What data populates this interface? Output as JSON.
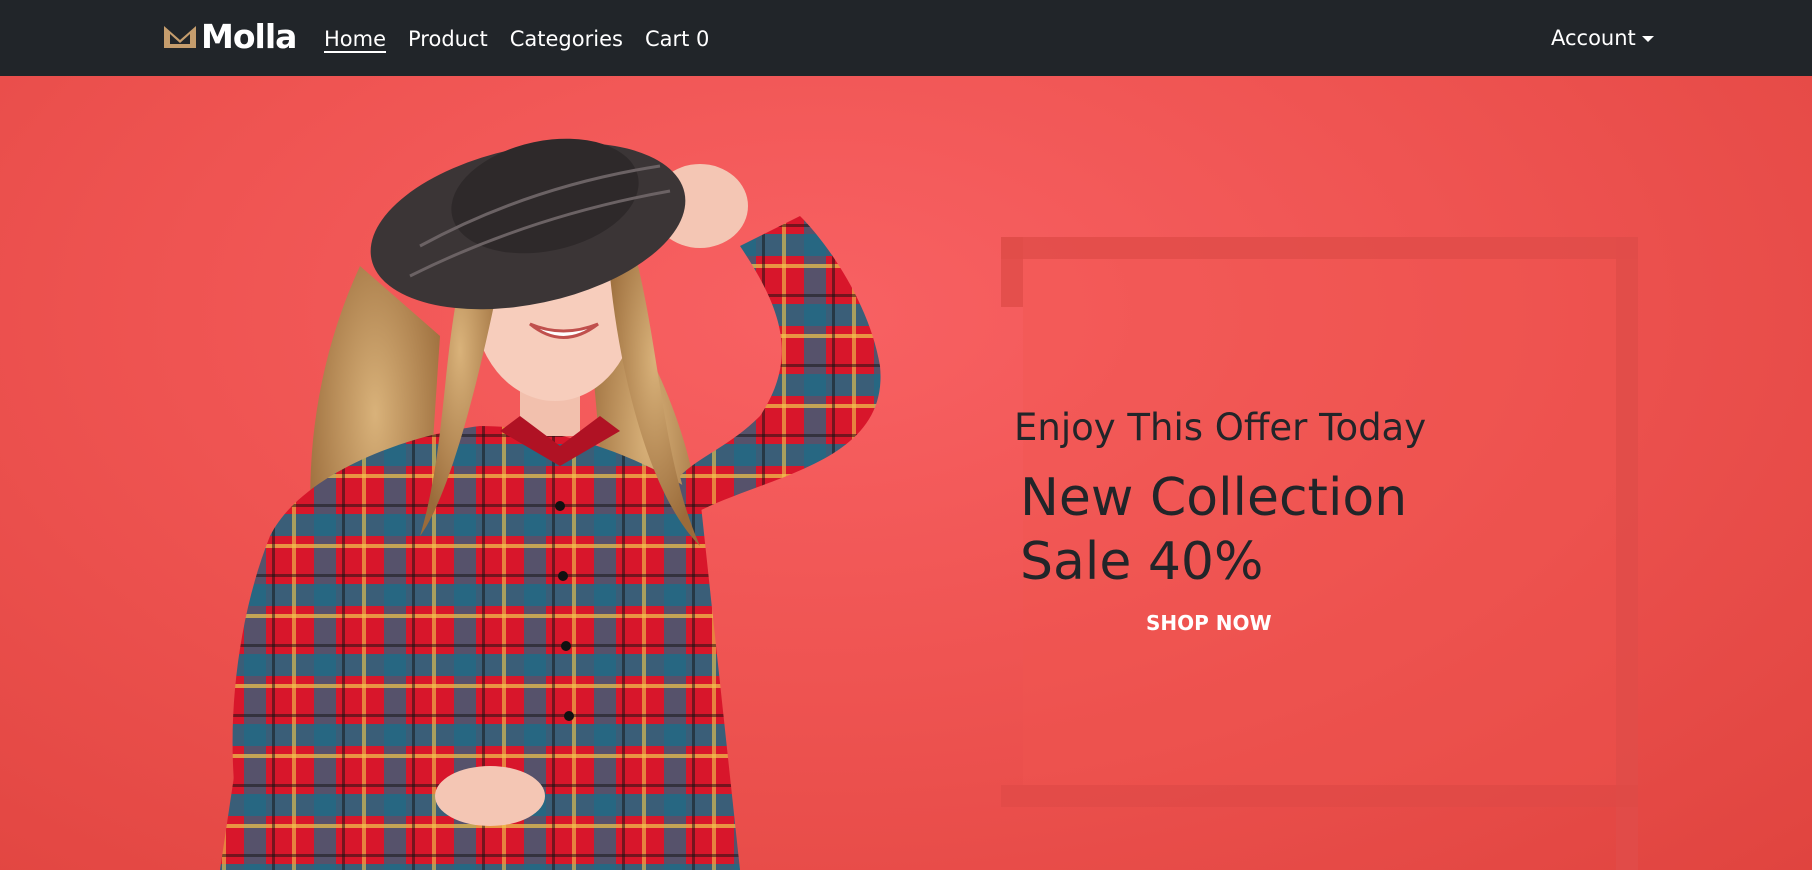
{
  "navbar": {
    "brand": "Molla",
    "links": [
      {
        "label": "Home",
        "active": true
      },
      {
        "label": "Product",
        "active": false
      },
      {
        "label": "Categories",
        "active": false
      },
      {
        "label": "Cart 0",
        "active": false
      }
    ],
    "account_label": "Account"
  },
  "hero": {
    "subtitle": "Enjoy This Offer Today",
    "title_line1": "New Collection",
    "title_line2": "Sale 40%",
    "cta": "SHOP NOW"
  },
  "colors": {
    "navbar_bg": "#212529",
    "hero_bg": "#ee5652",
    "brand_accent": "#c59d6d",
    "hero_text": "#222529"
  },
  "icons": [
    "molla-logo-icon",
    "account-caret-icon"
  ]
}
